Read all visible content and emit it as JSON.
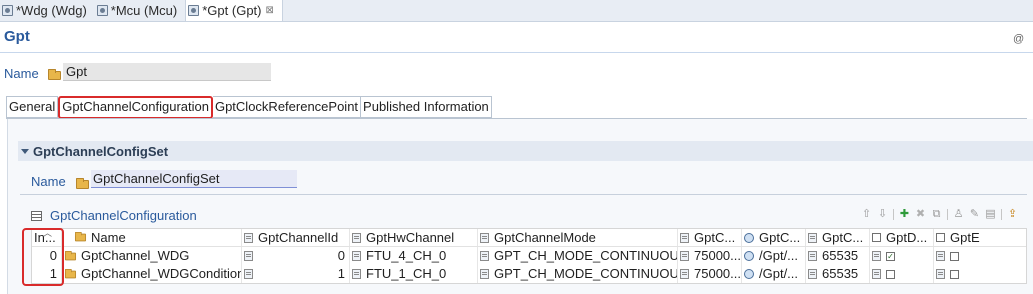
{
  "editor_tabs": [
    {
      "label": "*Wdg (Wdg)",
      "active": false
    },
    {
      "label": "*Mcu (Mcu)",
      "active": false
    },
    {
      "label": "*Gpt (Gpt)",
      "active": true,
      "close": "⊠"
    }
  ],
  "page": {
    "title": "Gpt",
    "at_symbol": "@"
  },
  "name_row": {
    "label": "Name",
    "value": "Gpt"
  },
  "section_tabs": [
    "General",
    "GptChannelConfiguration",
    "GptClockReferencePoint",
    "Published Information"
  ],
  "active_section_tab": 1,
  "section": {
    "title": "GptChannelConfigSet",
    "name_label": "Name",
    "name_value": "GptChannelConfigSet"
  },
  "table": {
    "caption": "GptChannelConfiguration",
    "toolbar_icons": [
      "up-icon",
      "down-icon",
      "add-icon",
      "delete-icon",
      "copy-icon",
      "person-icon",
      "edit-icon",
      "properties-icon",
      "export-icon"
    ],
    "columns": [
      "In...",
      "Name",
      "GptChannelId",
      "GptHwChannel",
      "GptChannelMode",
      "GptC...",
      "GptC...",
      "GptC...",
      "GptD...",
      "GptE"
    ],
    "rows": [
      {
        "index": "0",
        "name": "GptChannel_WDG",
        "id": "0",
        "hw": "FTU_4_CH_0",
        "mode": "GPT_CH_MODE_CONTINUOUS",
        "c1": "75000...",
        "c2": "/Gpt/...",
        "c3": "65535",
        "c4_checked": true,
        "c5_checked": false
      },
      {
        "index": "1",
        "name": "GptChannel_WDGCondition",
        "id": "1",
        "hw": "FTU_1_CH_0",
        "mode": "GPT_CH_MODE_CONTINUOUS",
        "c1": "75000...",
        "c2": "/Gpt/...",
        "c3": "65535",
        "c4_checked": false,
        "c5_checked": false
      }
    ]
  },
  "colors": {
    "accent": "#2a5a9c",
    "highlight": "#d92b2b",
    "header_bg": "#e3e9f2"
  }
}
